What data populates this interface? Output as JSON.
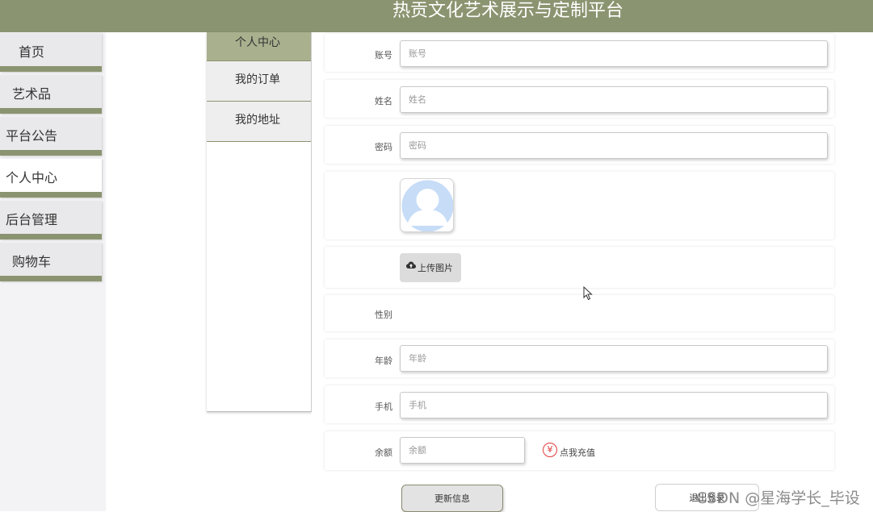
{
  "header": {
    "title": "热贡文化艺术展示与定制平台",
    "background": "#8b9470"
  },
  "sidebar": {
    "items": [
      {
        "label": "首页",
        "active": false
      },
      {
        "label": "艺术品",
        "active": false
      },
      {
        "label": "平台公告",
        "active": false
      },
      {
        "label": "个人中心",
        "active": true
      },
      {
        "label": "后台管理",
        "active": false
      },
      {
        "label": "购物车",
        "active": false
      }
    ]
  },
  "subnav": {
    "items": [
      {
        "label": "个人中心",
        "active": true
      },
      {
        "label": "我的订单",
        "active": false
      },
      {
        "label": "我的地址",
        "active": false
      }
    ]
  },
  "form": {
    "account": {
      "label": "账号",
      "placeholder": "账号"
    },
    "name": {
      "label": "姓名",
      "placeholder": "姓名"
    },
    "password": {
      "label": "密码",
      "placeholder": "密码"
    },
    "avatar": {
      "icon": "default-user-avatar-icon"
    },
    "upload": {
      "label": "上传图片",
      "icon": "cloud-upload-icon"
    },
    "gender": {
      "label": "性别"
    },
    "age": {
      "label": "年龄",
      "placeholder": "年龄"
    },
    "phone": {
      "label": "手机",
      "placeholder": "手机"
    },
    "balance": {
      "label": "余额",
      "placeholder": "余额",
      "recharge_symbol": "¥",
      "recharge_label": "点我充值"
    },
    "update_button": "更新信息",
    "logout_button": "退出登录"
  },
  "watermark": "CSDN @星海学长_毕设",
  "colors": {
    "accent": "#8b9470",
    "subnav_active": "#a9b08e",
    "recharge": "#e13a3a"
  }
}
